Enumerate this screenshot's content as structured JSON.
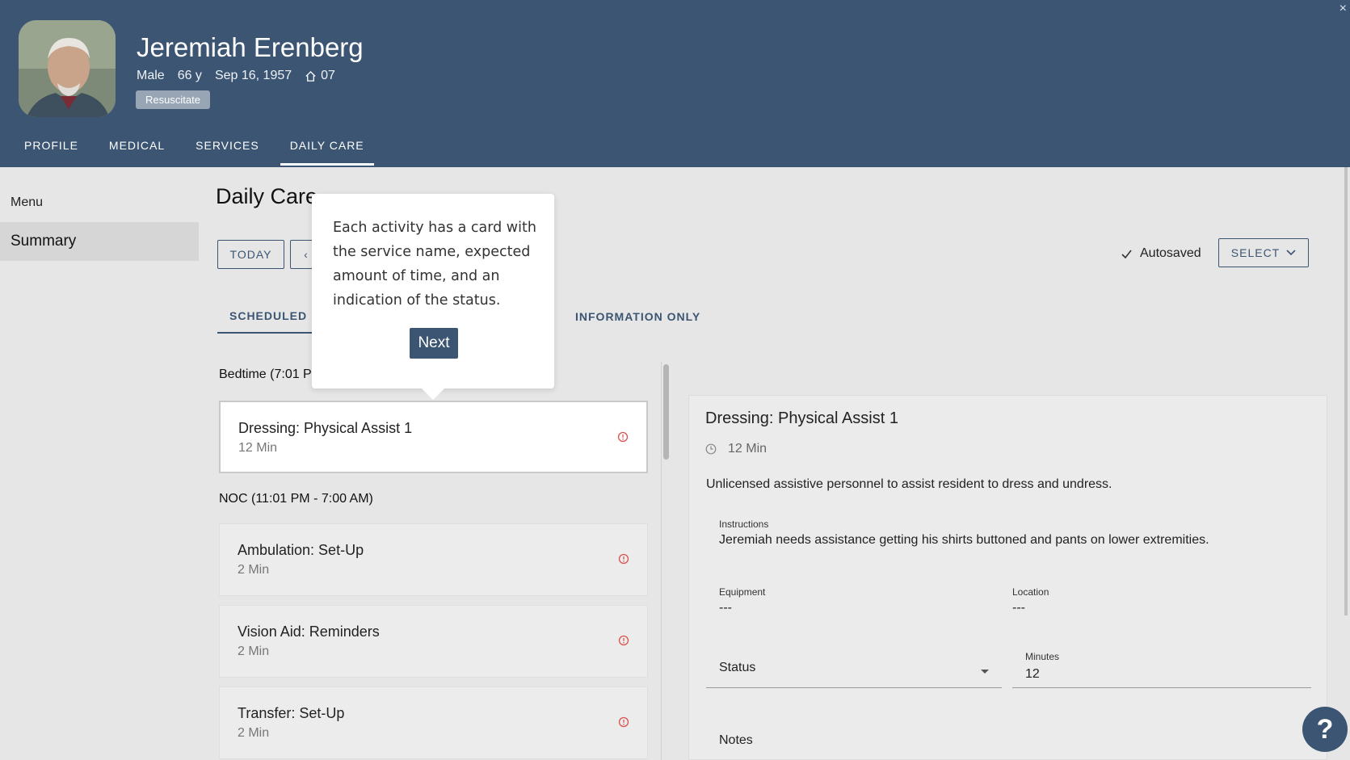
{
  "header": {
    "close_glyph": "×",
    "patient_name": "Jeremiah Erenberg",
    "sex": "Male",
    "age": "66 y",
    "dob": "Sep 16, 1957",
    "room": "07",
    "code_status": "Resuscitate",
    "tabs": [
      {
        "label": "PROFILE"
      },
      {
        "label": "MEDICAL"
      },
      {
        "label": "SERVICES"
      },
      {
        "label": "DAILY CARE",
        "active": true
      }
    ]
  },
  "sidebar": {
    "menu_label": "Menu",
    "items": [
      {
        "label": "Summary",
        "selected": true
      }
    ]
  },
  "main": {
    "title": "Daily Care",
    "today_label": "TODAY",
    "prev_glyph": "‹",
    "autosaved_label": "Autosaved",
    "select_label": "SELECT",
    "tabs": [
      {
        "label": "SCHEDULED",
        "active": true
      },
      {
        "label": "INFORMATION ONLY"
      }
    ],
    "groups": [
      {
        "label": "Bedtime (7:01 P",
        "cards": [
          {
            "title": "Dressing: Physical Assist 1",
            "time": "12 Min",
            "selected": true
          }
        ]
      },
      {
        "label": "NOC (11:01 PM - 7:00 AM)",
        "cards": [
          {
            "title": "Ambulation: Set-Up",
            "time": "2 Min"
          },
          {
            "title": "Vision Aid: Reminders",
            "time": "2 Min"
          },
          {
            "title": "Transfer: Set-Up",
            "time": "2 Min"
          }
        ]
      }
    ]
  },
  "detail": {
    "title": "Dressing: Physical Assist 1",
    "time": "12 Min",
    "description": "Unlicensed assistive personnel to assist resident to dress and undress.",
    "instructions_label": "Instructions",
    "instructions": "Jeremiah needs assistance getting his shirts buttoned and pants on lower extremities.",
    "equipment_label": "Equipment",
    "equipment": "---",
    "location_label": "Location",
    "location": "---",
    "status_label": "Status",
    "minutes_label": "Minutes",
    "minutes": "12",
    "notes_label": "Notes"
  },
  "tooltip": {
    "text": "Each activity has a card with the service name, expected amount of time, and an indication of the status.",
    "next_label": "Next"
  },
  "help_label": "?",
  "colors": {
    "header_bg": "#3b5573",
    "accent": "#3b5573",
    "status_alert": "#d9534f"
  }
}
